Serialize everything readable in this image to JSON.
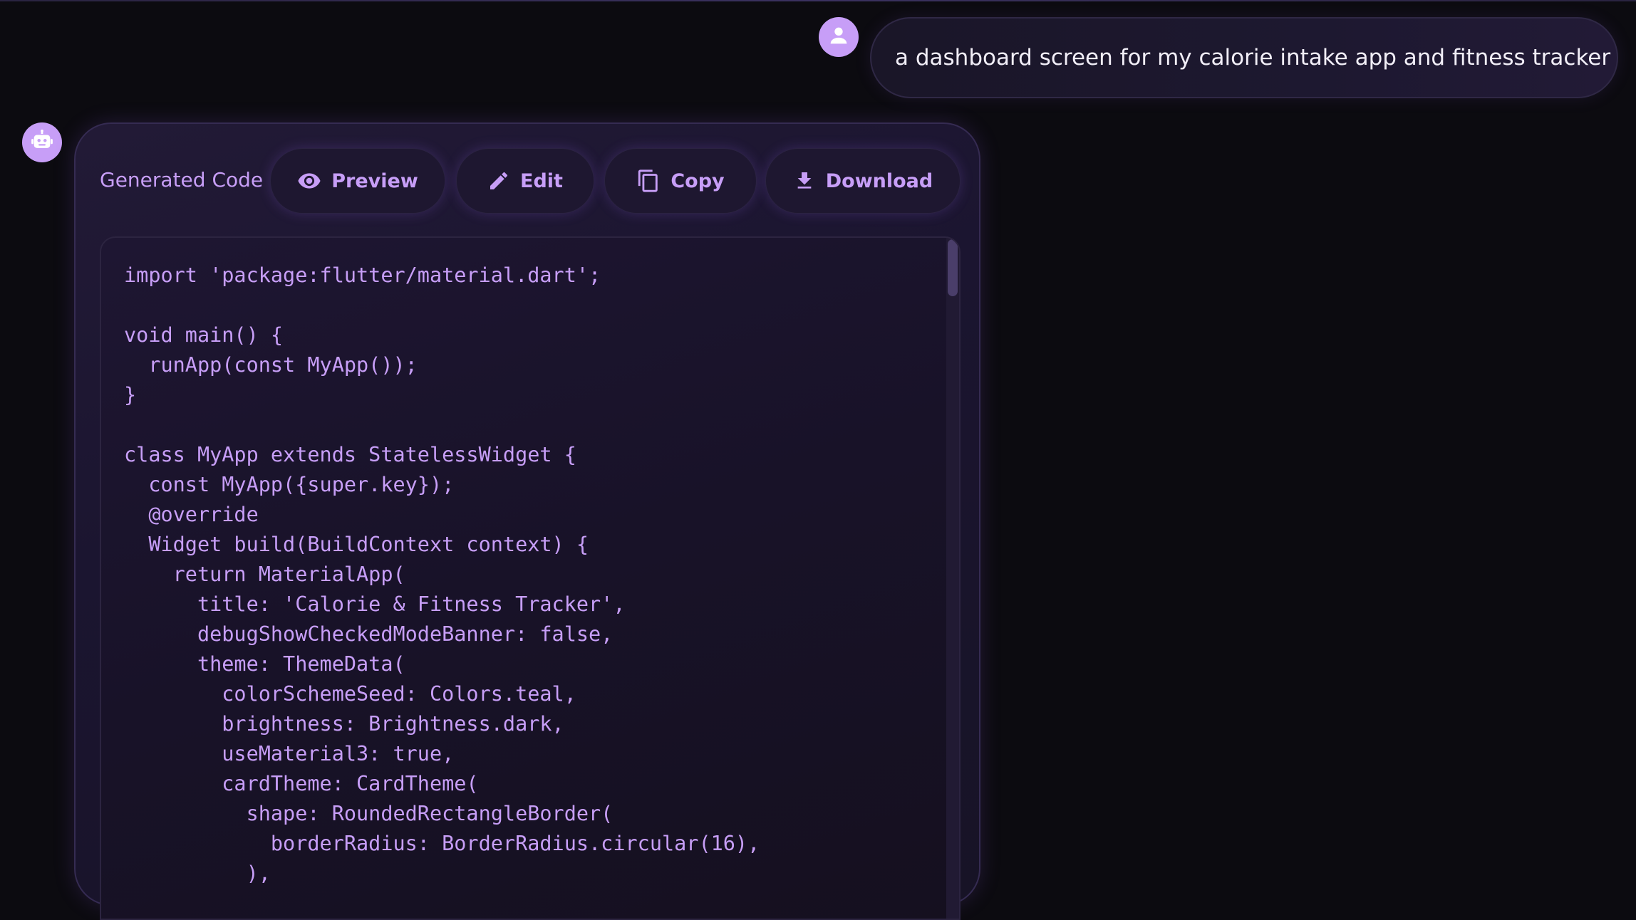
{
  "user_message": {
    "avatar_icon": "person-icon",
    "text": "a dashboard screen for my calorie intake app and fitness tracker"
  },
  "bot_message": {
    "avatar_icon": "robot-icon",
    "card": {
      "title": "Generated Code",
      "buttons": {
        "preview": {
          "label": "Preview",
          "icon": "eye-icon"
        },
        "edit": {
          "label": "Edit",
          "icon": "pencil-icon"
        },
        "copy": {
          "label": "Copy",
          "icon": "copy-icon"
        },
        "download": {
          "label": "Download",
          "icon": "download-icon"
        }
      },
      "code": "import 'package:flutter/material.dart';\n\nvoid main() {\n  runApp(const MyApp());\n}\n\nclass MyApp extends StatelessWidget {\n  const MyApp({super.key});\n  @override\n  Widget build(BuildContext context) {\n    return MaterialApp(\n      title: 'Calorie & Fitness Tracker',\n      debugShowCheckedModeBanner: false,\n      theme: ThemeData(\n        colorSchemeSeed: Colors.teal,\n        brightness: Brightness.dark,\n        useMaterial3: true,\n        cardTheme: CardTheme(\n          shape: RoundedRectangleBorder(\n            borderRadius: BorderRadius.circular(16),\n          ),"
    }
  },
  "colors": {
    "accent": "#c79ef7",
    "background": "#0c0b10",
    "card": "#1b1530",
    "user_text": "#f1eef7"
  }
}
